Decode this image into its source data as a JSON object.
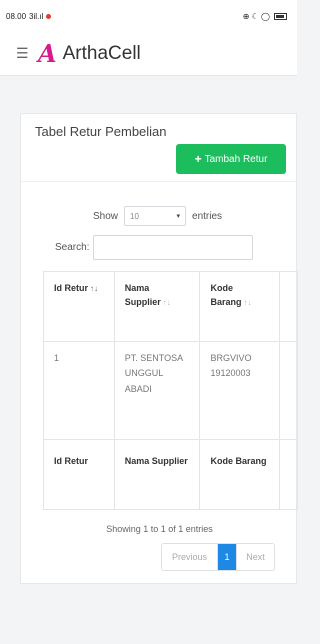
{
  "status_bar": {
    "time": "08.00",
    "signal": "3il.ıl",
    "right_icons": "⊕ ☾ ◯"
  },
  "app": {
    "logo_letter": "A",
    "name": "ArthaCell",
    "menu_icon": "hamburger-icon"
  },
  "card": {
    "title": "Tabel Retur Pembelian",
    "add_button": "Tambah Retur",
    "add_icon": "+"
  },
  "length_control": {
    "before": "Show",
    "value": "10",
    "after": "entries"
  },
  "search": {
    "label": "Search:",
    "value": "",
    "placeholder": ""
  },
  "table": {
    "headers": [
      {
        "label": "Id Retur",
        "sort": "↑↓"
      },
      {
        "label": "Nama Supplier",
        "sort": "↑↓"
      },
      {
        "label": "Kode Barang",
        "sort": "↑↓"
      }
    ],
    "rows": [
      [
        "1",
        "PT. SENTOSA UNGGUL ABADI",
        "BRGVIVO 19120003"
      ]
    ],
    "footers": [
      "Id Retur",
      "Nama Supplier",
      "Kode Barang"
    ]
  },
  "info": "Showing 1 to 1 of 1 entries",
  "pagination": {
    "previous": "Previous",
    "current": "1",
    "next": "Next"
  },
  "colors": {
    "brand": "#d81b8c",
    "add_button": "#1cbd5c",
    "active_page": "#1e88e5"
  }
}
